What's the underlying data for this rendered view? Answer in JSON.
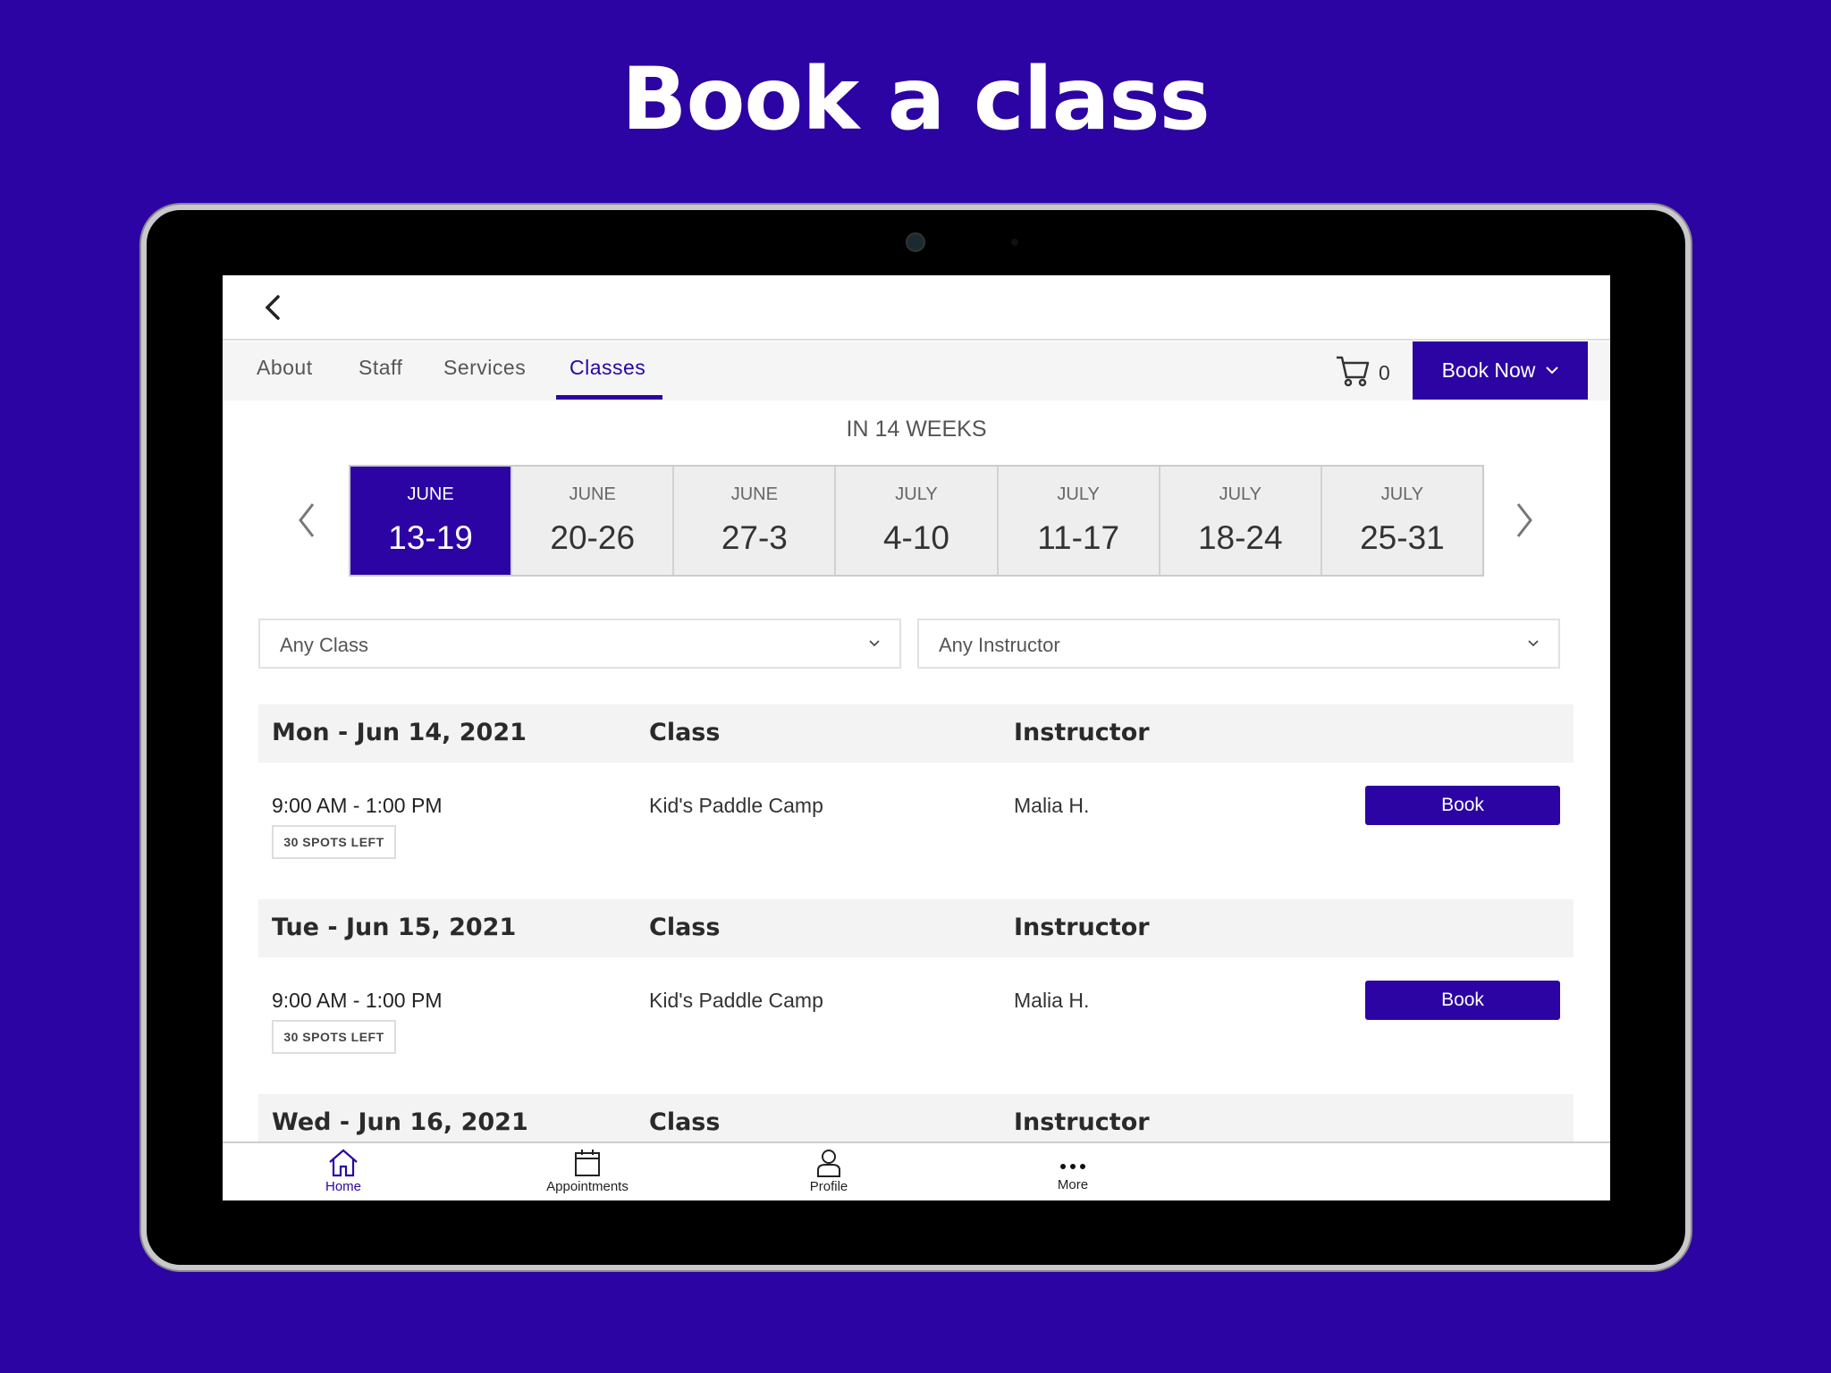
{
  "headline": "Book a class",
  "nav": {
    "tabs": [
      {
        "label": "About"
      },
      {
        "label": "Staff"
      },
      {
        "label": "Services"
      },
      {
        "label": "Classes",
        "active": true
      }
    ],
    "cart_count": "0",
    "book_now": "Book Now"
  },
  "weeks": {
    "label": "IN 14 WEEKS",
    "items": [
      {
        "month": "JUNE",
        "range": "13-19",
        "selected": true
      },
      {
        "month": "JUNE",
        "range": "20-26"
      },
      {
        "month": "JUNE",
        "range": "27-3"
      },
      {
        "month": "JULY",
        "range": "4-10"
      },
      {
        "month": "JULY",
        "range": "11-17"
      },
      {
        "month": "JULY",
        "range": "18-24"
      },
      {
        "month": "JULY",
        "range": "25-31"
      }
    ]
  },
  "filters": {
    "class": "Any Class",
    "instructor": "Any Instructor"
  },
  "columns": {
    "class": "Class",
    "instructor": "Instructor"
  },
  "days": [
    {
      "date": "Mon - Jun 14, 2021",
      "rows": [
        {
          "time": "9:00 AM - 1:00 PM",
          "spots": "30 SPOTS LEFT",
          "class": "Kid's Paddle Camp",
          "instructor": "Malia H.",
          "action": "Book"
        }
      ]
    },
    {
      "date": "Tue - Jun 15, 2021",
      "rows": [
        {
          "time": "9:00 AM - 1:00 PM",
          "spots": "30 SPOTS LEFT",
          "class": "Kid's Paddle Camp",
          "instructor": "Malia H.",
          "action": "Book"
        }
      ]
    },
    {
      "date": "Wed - Jun 16, 2021"
    }
  ],
  "bottom_nav": [
    {
      "label": "Home",
      "icon": "home-icon",
      "active": true
    },
    {
      "label": "Appointments",
      "icon": "calendar-icon"
    },
    {
      "label": "Profile",
      "icon": "person-icon"
    },
    {
      "label": "More",
      "icon": "more-icon"
    }
  ],
  "colors": {
    "brand": "#2c04a3"
  }
}
